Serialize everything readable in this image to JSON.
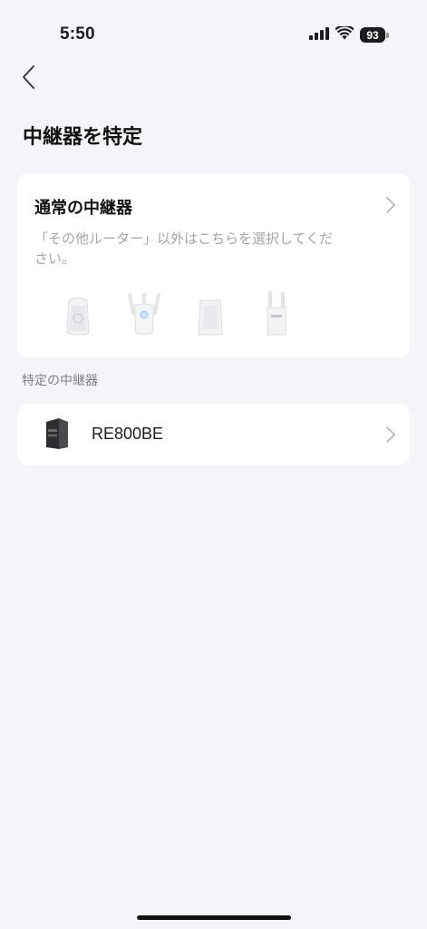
{
  "status_bar": {
    "time": "5:50",
    "battery": "93"
  },
  "header": {
    "title": "中継器を特定"
  },
  "standard_repeater": {
    "title": "通常の中継器",
    "description": "「その他ルーター」以外はこちらを選択してください。",
    "device_icons": [
      "plug-in-extender-icon",
      "three-antenna-extender-icon",
      "desktop-extender-icon",
      "two-antenna-extender-icon"
    ]
  },
  "specific_section": {
    "label": "特定の中継器",
    "items": [
      {
        "model": "RE800BE"
      }
    ]
  },
  "colors": {
    "background": "#f4f5f9",
    "card": "#ffffff",
    "muted_text": "#a3a5ab"
  }
}
